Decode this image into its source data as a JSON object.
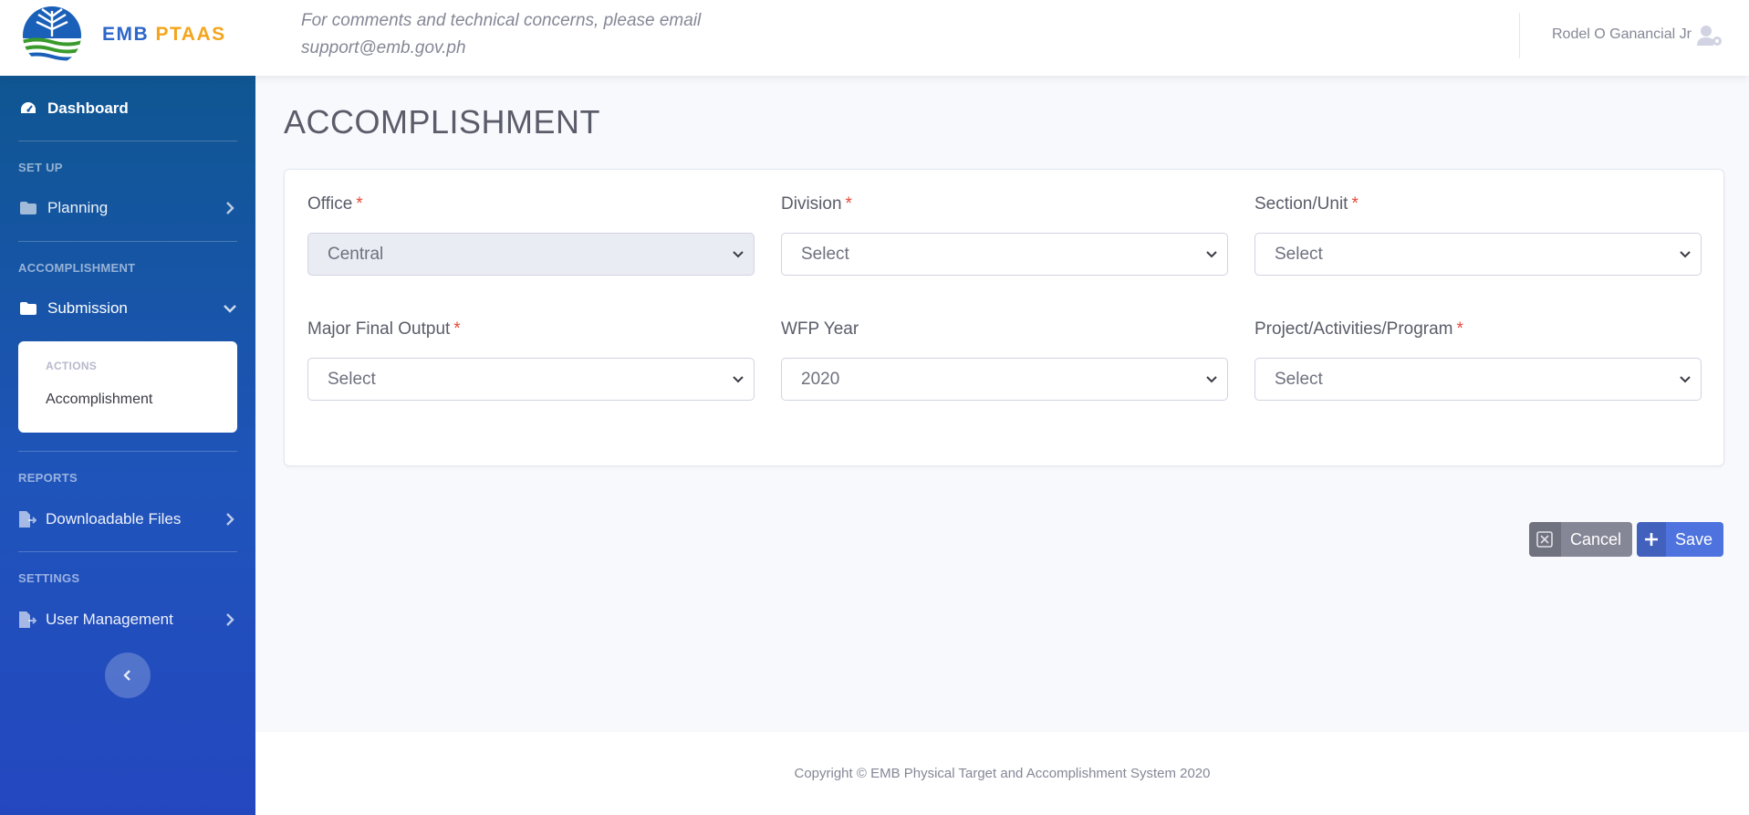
{
  "brand": {
    "part1": "EMB",
    "part2": "PTAAS",
    "colors": {
      "part1": "#2c67c9",
      "part2": "#f4a51c"
    }
  },
  "topbar": {
    "notice_line1": "For comments and technical concerns, please email",
    "notice_line2": "support@emb.gov.ph",
    "user_name": "Rodel O Ganancial Jr",
    "user_icon": "user-cog-icon"
  },
  "sidebar": {
    "dashboard": {
      "label": "Dashboard",
      "icon": "tachometer-icon"
    },
    "headings": {
      "setup": "SET UP",
      "accomplishment": "ACCOMPLISHMENT",
      "reports": "REPORTS",
      "settings": "SETTINGS"
    },
    "planning": {
      "label": "Planning",
      "icon": "folder-icon"
    },
    "submission": {
      "label": "Submission",
      "icon": "folder-open-icon"
    },
    "submenu": {
      "heading": "ACTIONS",
      "items": [
        {
          "label": "Accomplishment"
        }
      ]
    },
    "downloadable": {
      "label": "Downloadable Files",
      "icon": "file-export-icon"
    },
    "user_management": {
      "label": "User Management",
      "icon": "file-export-icon"
    },
    "gradient": [
      "#0f5692",
      "#2447c0"
    ]
  },
  "main": {
    "title": "ACCOMPLISHMENT",
    "form": {
      "required_mark": "*",
      "office": {
        "label": "Office",
        "value": "Central",
        "required": true,
        "disabled": true
      },
      "division": {
        "label": "Division",
        "value": "Select",
        "required": true
      },
      "section": {
        "label": "Section/Unit",
        "value": "Select",
        "required": true
      },
      "mfo": {
        "label": "Major Final Output",
        "value": "Select",
        "required": true
      },
      "wfp_year": {
        "label": "WFP Year",
        "value": "2020",
        "required": false
      },
      "pap": {
        "label": "Project/Activities/Program",
        "value": "Select",
        "required": true
      }
    },
    "buttons": {
      "cancel": {
        "label": "Cancel",
        "icon": "close-box-icon",
        "color": "#858796"
      },
      "save": {
        "label": "Save",
        "icon": "plus-icon",
        "color": "#4e73df"
      }
    }
  },
  "footer": {
    "copyright": "Copyright © EMB Physical Target and Accomplishment System 2020"
  }
}
